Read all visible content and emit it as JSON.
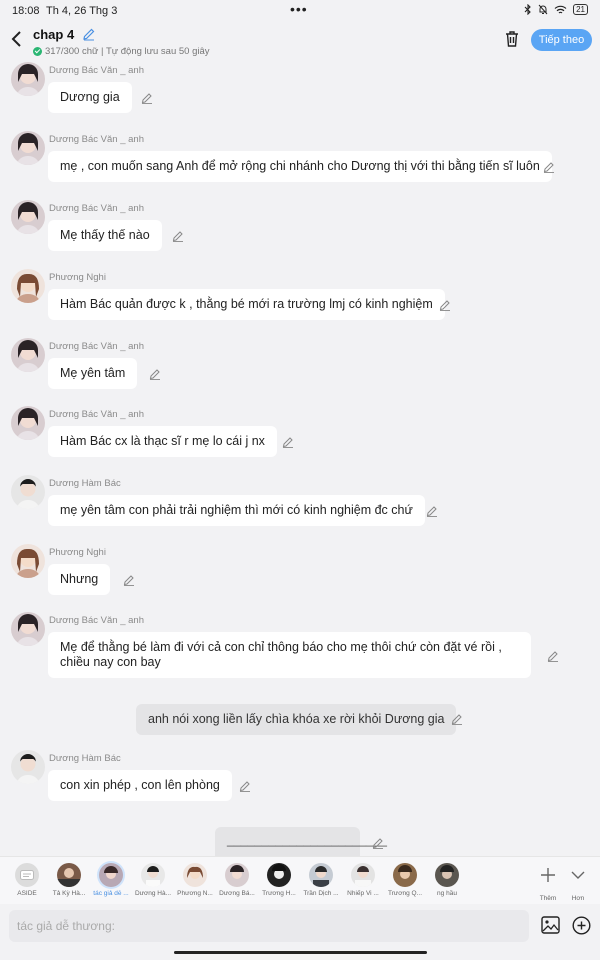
{
  "status": {
    "time": "18:08",
    "date": "Th 4, 26 Thg 3",
    "dots": "•••",
    "battery": "21"
  },
  "header": {
    "title": "chap 4",
    "subtitle": "317/300 chữ | Tự động lưu sau 50 giây",
    "next_label": "Tiếp theo"
  },
  "messages": [
    {
      "name": "Dương Bác Văn _ anh",
      "text": "Dương gia"
    },
    {
      "name": "Dương Bác Văn _ anh",
      "text": "mẹ , con muốn sang Anh để mở rộng chi nhánh cho Dương thị với thi bằng tiến sĩ luôn"
    },
    {
      "name": "Dương Bác Văn _ anh",
      "text": "Mẹ thấy thế nào"
    },
    {
      "name": "Phương Nghi",
      "text": "Hàm Bác quản được k , thằng bé mới ra trường lmj có kinh nghiệm"
    },
    {
      "name": "Dương Bác Văn _ anh",
      "text": "Mẹ yên tâm"
    },
    {
      "name": "Dương Bác Văn _ anh",
      "text": "Hàm Bác cx là thạc sĩ r mẹ lo cái j nx"
    },
    {
      "name": "Dương Hàm Bác",
      "text": "mẹ yên tâm con phải trải nghiệm thì mới có kinh nghiệm đc chứ"
    },
    {
      "name": "Phương Nghi",
      "text": "Nhưng"
    },
    {
      "name": "Dương Bác Văn _ anh",
      "text": "Mẹ để thằng bé làm đi với cả con chỉ thông báo cho mẹ thôi chứ còn đặt vé rồi , chiều nay con bay"
    },
    {
      "name": "",
      "text": "anh nói xong liền lấy chìa khóa xe rời khỏi Dương gia"
    },
    {
      "name": "Dương Hàm Bác",
      "text": "con xin phép , con lên phòng"
    },
    {
      "name": "",
      "text": "_______________________"
    }
  ],
  "tray": {
    "characters": [
      {
        "label": "ASIDE"
      },
      {
        "label": "Tả Kỳ Hà..."
      },
      {
        "label": "tác giả dễ ..."
      },
      {
        "label": "Dương Hà..."
      },
      {
        "label": "Phương N..."
      },
      {
        "label": "Dương Bá..."
      },
      {
        "label": "Trương H..."
      },
      {
        "label": "Trần Dịch ..."
      },
      {
        "label": "Nhiếp Vi ..."
      },
      {
        "label": "Trương Q..."
      },
      {
        "label": "ng hầu"
      }
    ],
    "more_label": "Thêm",
    "collapse_label": "Hơn"
  },
  "input": {
    "placeholder": "tác giả dễ thương:"
  },
  "colors": {
    "accent": "#5aa5f4",
    "bubble": "#ffffff",
    "narration": "#e4e4e6",
    "background": "#f2f2f4"
  }
}
